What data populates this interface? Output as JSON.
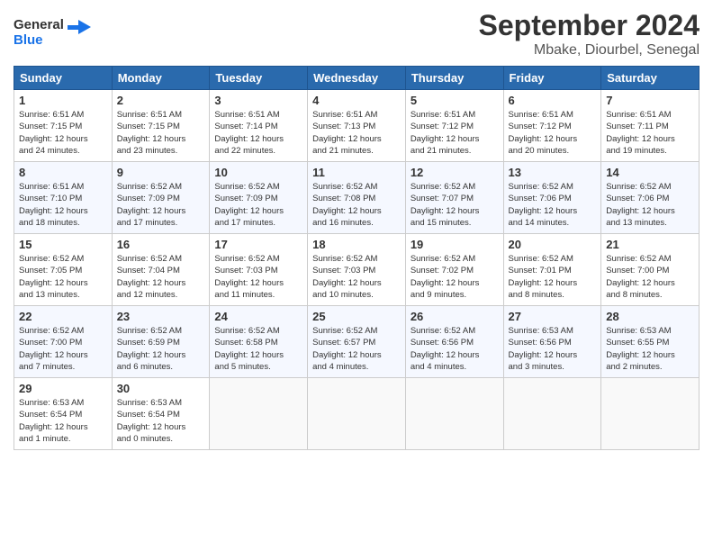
{
  "logo": {
    "line1": "General",
    "line2": "Blue"
  },
  "title": "September 2024",
  "location": "Mbake, Diourbel, Senegal",
  "days_of_week": [
    "Sunday",
    "Monday",
    "Tuesday",
    "Wednesday",
    "Thursday",
    "Friday",
    "Saturday"
  ],
  "weeks": [
    [
      {
        "day": "1",
        "detail": "Sunrise: 6:51 AM\nSunset: 7:15 PM\nDaylight: 12 hours\nand 24 minutes."
      },
      {
        "day": "2",
        "detail": "Sunrise: 6:51 AM\nSunset: 7:15 PM\nDaylight: 12 hours\nand 23 minutes."
      },
      {
        "day": "3",
        "detail": "Sunrise: 6:51 AM\nSunset: 7:14 PM\nDaylight: 12 hours\nand 22 minutes."
      },
      {
        "day": "4",
        "detail": "Sunrise: 6:51 AM\nSunset: 7:13 PM\nDaylight: 12 hours\nand 21 minutes."
      },
      {
        "day": "5",
        "detail": "Sunrise: 6:51 AM\nSunset: 7:12 PM\nDaylight: 12 hours\nand 21 minutes."
      },
      {
        "day": "6",
        "detail": "Sunrise: 6:51 AM\nSunset: 7:12 PM\nDaylight: 12 hours\nand 20 minutes."
      },
      {
        "day": "7",
        "detail": "Sunrise: 6:51 AM\nSunset: 7:11 PM\nDaylight: 12 hours\nand 19 minutes."
      }
    ],
    [
      {
        "day": "8",
        "detail": "Sunrise: 6:51 AM\nSunset: 7:10 PM\nDaylight: 12 hours\nand 18 minutes."
      },
      {
        "day": "9",
        "detail": "Sunrise: 6:52 AM\nSunset: 7:09 PM\nDaylight: 12 hours\nand 17 minutes."
      },
      {
        "day": "10",
        "detail": "Sunrise: 6:52 AM\nSunset: 7:09 PM\nDaylight: 12 hours\nand 17 minutes."
      },
      {
        "day": "11",
        "detail": "Sunrise: 6:52 AM\nSunset: 7:08 PM\nDaylight: 12 hours\nand 16 minutes."
      },
      {
        "day": "12",
        "detail": "Sunrise: 6:52 AM\nSunset: 7:07 PM\nDaylight: 12 hours\nand 15 minutes."
      },
      {
        "day": "13",
        "detail": "Sunrise: 6:52 AM\nSunset: 7:06 PM\nDaylight: 12 hours\nand 14 minutes."
      },
      {
        "day": "14",
        "detail": "Sunrise: 6:52 AM\nSunset: 7:06 PM\nDaylight: 12 hours\nand 13 minutes."
      }
    ],
    [
      {
        "day": "15",
        "detail": "Sunrise: 6:52 AM\nSunset: 7:05 PM\nDaylight: 12 hours\nand 13 minutes."
      },
      {
        "day": "16",
        "detail": "Sunrise: 6:52 AM\nSunset: 7:04 PM\nDaylight: 12 hours\nand 12 minutes."
      },
      {
        "day": "17",
        "detail": "Sunrise: 6:52 AM\nSunset: 7:03 PM\nDaylight: 12 hours\nand 11 minutes."
      },
      {
        "day": "18",
        "detail": "Sunrise: 6:52 AM\nSunset: 7:03 PM\nDaylight: 12 hours\nand 10 minutes."
      },
      {
        "day": "19",
        "detail": "Sunrise: 6:52 AM\nSunset: 7:02 PM\nDaylight: 12 hours\nand 9 minutes."
      },
      {
        "day": "20",
        "detail": "Sunrise: 6:52 AM\nSunset: 7:01 PM\nDaylight: 12 hours\nand 8 minutes."
      },
      {
        "day": "21",
        "detail": "Sunrise: 6:52 AM\nSunset: 7:00 PM\nDaylight: 12 hours\nand 8 minutes."
      }
    ],
    [
      {
        "day": "22",
        "detail": "Sunrise: 6:52 AM\nSunset: 7:00 PM\nDaylight: 12 hours\nand 7 minutes."
      },
      {
        "day": "23",
        "detail": "Sunrise: 6:52 AM\nSunset: 6:59 PM\nDaylight: 12 hours\nand 6 minutes."
      },
      {
        "day": "24",
        "detail": "Sunrise: 6:52 AM\nSunset: 6:58 PM\nDaylight: 12 hours\nand 5 minutes."
      },
      {
        "day": "25",
        "detail": "Sunrise: 6:52 AM\nSunset: 6:57 PM\nDaylight: 12 hours\nand 4 minutes."
      },
      {
        "day": "26",
        "detail": "Sunrise: 6:52 AM\nSunset: 6:56 PM\nDaylight: 12 hours\nand 4 minutes."
      },
      {
        "day": "27",
        "detail": "Sunrise: 6:53 AM\nSunset: 6:56 PM\nDaylight: 12 hours\nand 3 minutes."
      },
      {
        "day": "28",
        "detail": "Sunrise: 6:53 AM\nSunset: 6:55 PM\nDaylight: 12 hours\nand 2 minutes."
      }
    ],
    [
      {
        "day": "29",
        "detail": "Sunrise: 6:53 AM\nSunset: 6:54 PM\nDaylight: 12 hours\nand 1 minute."
      },
      {
        "day": "30",
        "detail": "Sunrise: 6:53 AM\nSunset: 6:54 PM\nDaylight: 12 hours\nand 0 minutes."
      },
      {
        "day": "",
        "detail": ""
      },
      {
        "day": "",
        "detail": ""
      },
      {
        "day": "",
        "detail": ""
      },
      {
        "day": "",
        "detail": ""
      },
      {
        "day": "",
        "detail": ""
      }
    ]
  ]
}
